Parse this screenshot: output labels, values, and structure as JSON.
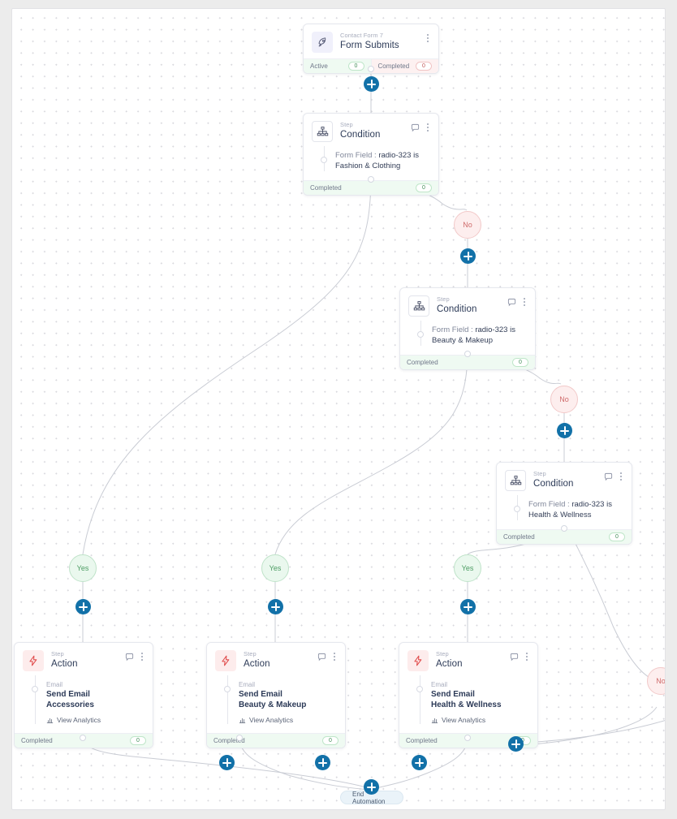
{
  "canvas": {
    "end_label": "End Automation"
  },
  "trigger": {
    "subtitle": "Contact Form 7",
    "title": "Form Submits",
    "icon": "rocket-icon",
    "menu_icon": "kebab-menu-icon",
    "stats": [
      {
        "label": "Active",
        "value": "0",
        "tone": "green"
      },
      {
        "label": "Completed",
        "value": "0",
        "tone": "red"
      }
    ]
  },
  "conditions": [
    {
      "subtitle": "Step",
      "title": "Condition",
      "prefix": "Form Field : ",
      "expression": "radio-323 is Fashion & Clothing",
      "footer_label": "Completed",
      "footer_value": "0"
    },
    {
      "subtitle": "Step",
      "title": "Condition",
      "prefix": "Form Field : ",
      "expression": "radio-323 is Beauty & Makeup",
      "footer_label": "Completed",
      "footer_value": "0"
    },
    {
      "subtitle": "Step",
      "title": "Condition",
      "prefix": "Form Field : ",
      "expression": "radio-323 is Health & Wellness",
      "footer_label": "Completed",
      "footer_value": "0"
    }
  ],
  "actions": [
    {
      "subtitle": "Step",
      "title": "Action",
      "kind": "Email",
      "name": "Send Email",
      "detail": "Accessories",
      "analytics_label": "View Analytics",
      "footer_label": "Completed",
      "footer_value": "0"
    },
    {
      "subtitle": "Step",
      "title": "Action",
      "kind": "Email",
      "name": "Send Email",
      "detail": "Beauty & Makeup",
      "analytics_label": "View Analytics",
      "footer_label": "Completed",
      "footer_value": "0"
    },
    {
      "subtitle": "Step",
      "title": "Action",
      "kind": "Email",
      "name": "Send Email",
      "detail": "Health & Wellness",
      "analytics_label": "View Analytics",
      "footer_label": "Completed",
      "footer_value": "0"
    }
  ],
  "branches": {
    "yes_label": "Yes",
    "no_label": "No"
  },
  "colors": {
    "accent": "#1271a8",
    "yes": "#4c9c63",
    "no": "#cf6a6a",
    "action_icon": "#e04a4a",
    "title": "#2c3a57"
  }
}
